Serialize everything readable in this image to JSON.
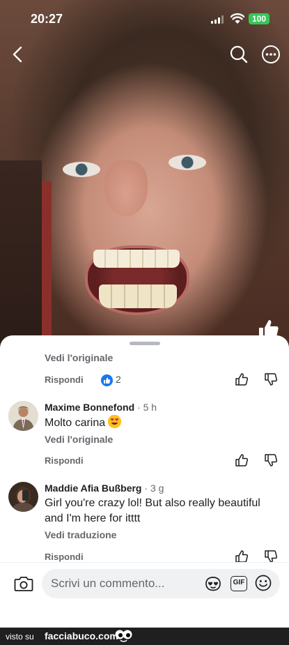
{
  "status_bar": {
    "time": "20:27",
    "battery": "100",
    "battery_color": "#35c759"
  },
  "top_controls": {
    "back_icon": "chevron-left-icon",
    "search_icon": "search-icon",
    "more_icon": "more-horizontal-icon"
  },
  "comments_sheet": {
    "partial_comment": {
      "see_original": "Vedi l'originale",
      "reply": "Rispondi",
      "reaction_icon": "thumbs-up-reaction-icon",
      "reaction_count": "2"
    },
    "comments": [
      {
        "author": "Maxime Bonnefond",
        "meta": " · 5 h",
        "text": "Molto carina",
        "emoji": "heart-eyes-emoji",
        "translate_link": "Vedi l'originale",
        "reply": "Rispondi"
      },
      {
        "author": "Maddie Afia Bußberg",
        "meta": " · 3 g",
        "text": "Girl you're crazy lol! But also really beautiful and I'm here for itttt",
        "translate_link": "Vedi traduzione",
        "reply": "Rispondi"
      }
    ]
  },
  "composer": {
    "placeholder": "Scrivi un commento...",
    "gif_label": "GIF",
    "camera_icon": "camera-icon",
    "avatar_icon": "avatar-sticker-icon",
    "emoji_icon": "smiley-icon"
  },
  "watermark": {
    "prefix": "visto su",
    "site": "facciabuco.com"
  },
  "colors": {
    "accent": "#1877f2",
    "muted_text": "#65676b",
    "text": "#1c1e21"
  }
}
